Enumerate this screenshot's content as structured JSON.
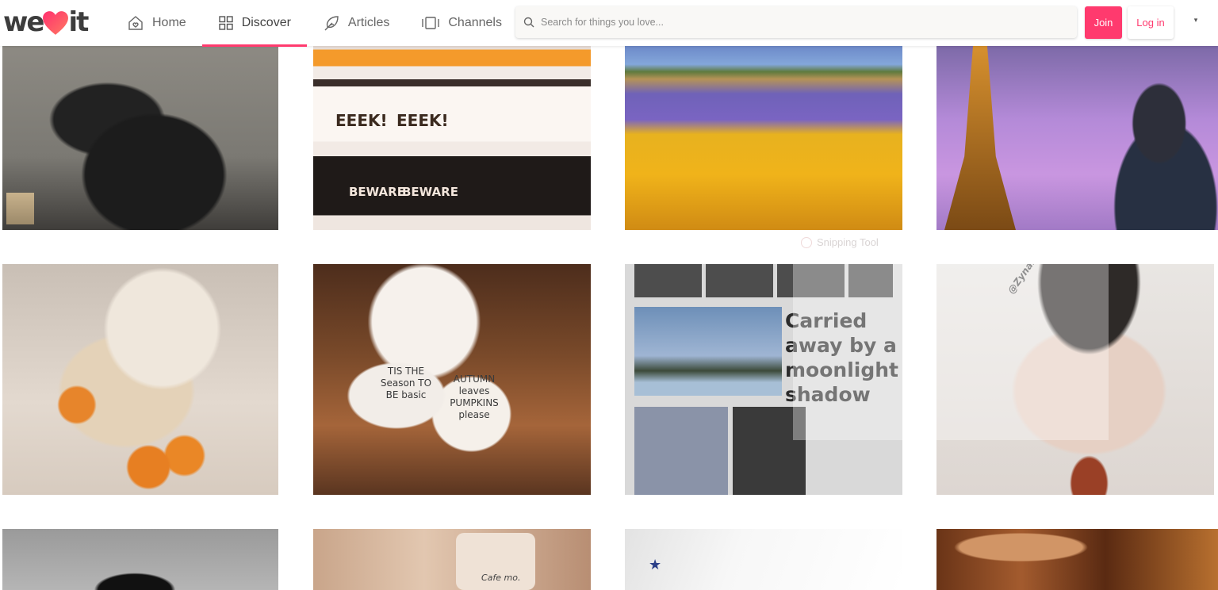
{
  "header": {
    "logo": {
      "left": "we",
      "right": "it",
      "icon": "heart-icon"
    },
    "nav": [
      {
        "label": "Home",
        "icon": "home-icon",
        "active": false
      },
      {
        "label": "Discover",
        "icon": "grid-icon",
        "active": true
      },
      {
        "label": "Articles",
        "icon": "feather-icon",
        "active": false
      },
      {
        "label": "Channels",
        "icon": "channels-icon",
        "active": false
      }
    ],
    "search": {
      "placeholder": "Search for things you love...",
      "value": ""
    },
    "join_label": "Join",
    "login_label": "Log in",
    "dropdown_icon": "▾"
  },
  "colors": {
    "accent": "#ff3a6e",
    "text": "#666666"
  },
  "overlay": {
    "title": "Snipping Tool"
  },
  "grid": {
    "rows": [
      [
        {
          "name": "tile-black-coat",
          "desc": "person in black coat on leather couch"
        },
        {
          "name": "tile-halloween-pumpkins",
          "desc": "pumpkins on shelves",
          "texts": [
            "EEEK!",
            "EEEK!",
            "BEWARE",
            "BEWARE"
          ]
        },
        {
          "name": "tile-sunflower-field",
          "desc": "painting of sunflowers and lavender field"
        },
        {
          "name": "tile-eiffel-tower",
          "desc": "girl photographing Eiffel Tower at dusk"
        }
      ],
      [
        {
          "name": "tile-cozy-gifts",
          "desc": "gifts, oranges and hot chocolate"
        },
        {
          "name": "tile-autumn-mugs",
          "desc": "two autumn mugs",
          "texts": [
            "TIS THE Season TO BE basic",
            "AUTUMN leaves PUMPKINS please"
          ]
        },
        {
          "name": "tile-moon-newspaper",
          "desc": "newspaper clipping",
          "headline": "Carried away by a moonlight shadow"
        },
        {
          "name": "tile-portrait-painting",
          "desc": "painting of woman with towel",
          "watermark": "@Zynar"
        }
      ],
      [
        {
          "name": "tile-grey-water",
          "desc": "dark figure in grey water"
        },
        {
          "name": "tile-beige-items",
          "desc": "beige items",
          "texts": [
            "Cafe mo."
          ]
        },
        {
          "name": "tile-white-phone-case",
          "desc": "white phone case with stars"
        },
        {
          "name": "tile-coffee-mug",
          "desc": "orange coffee mug"
        }
      ]
    ]
  }
}
